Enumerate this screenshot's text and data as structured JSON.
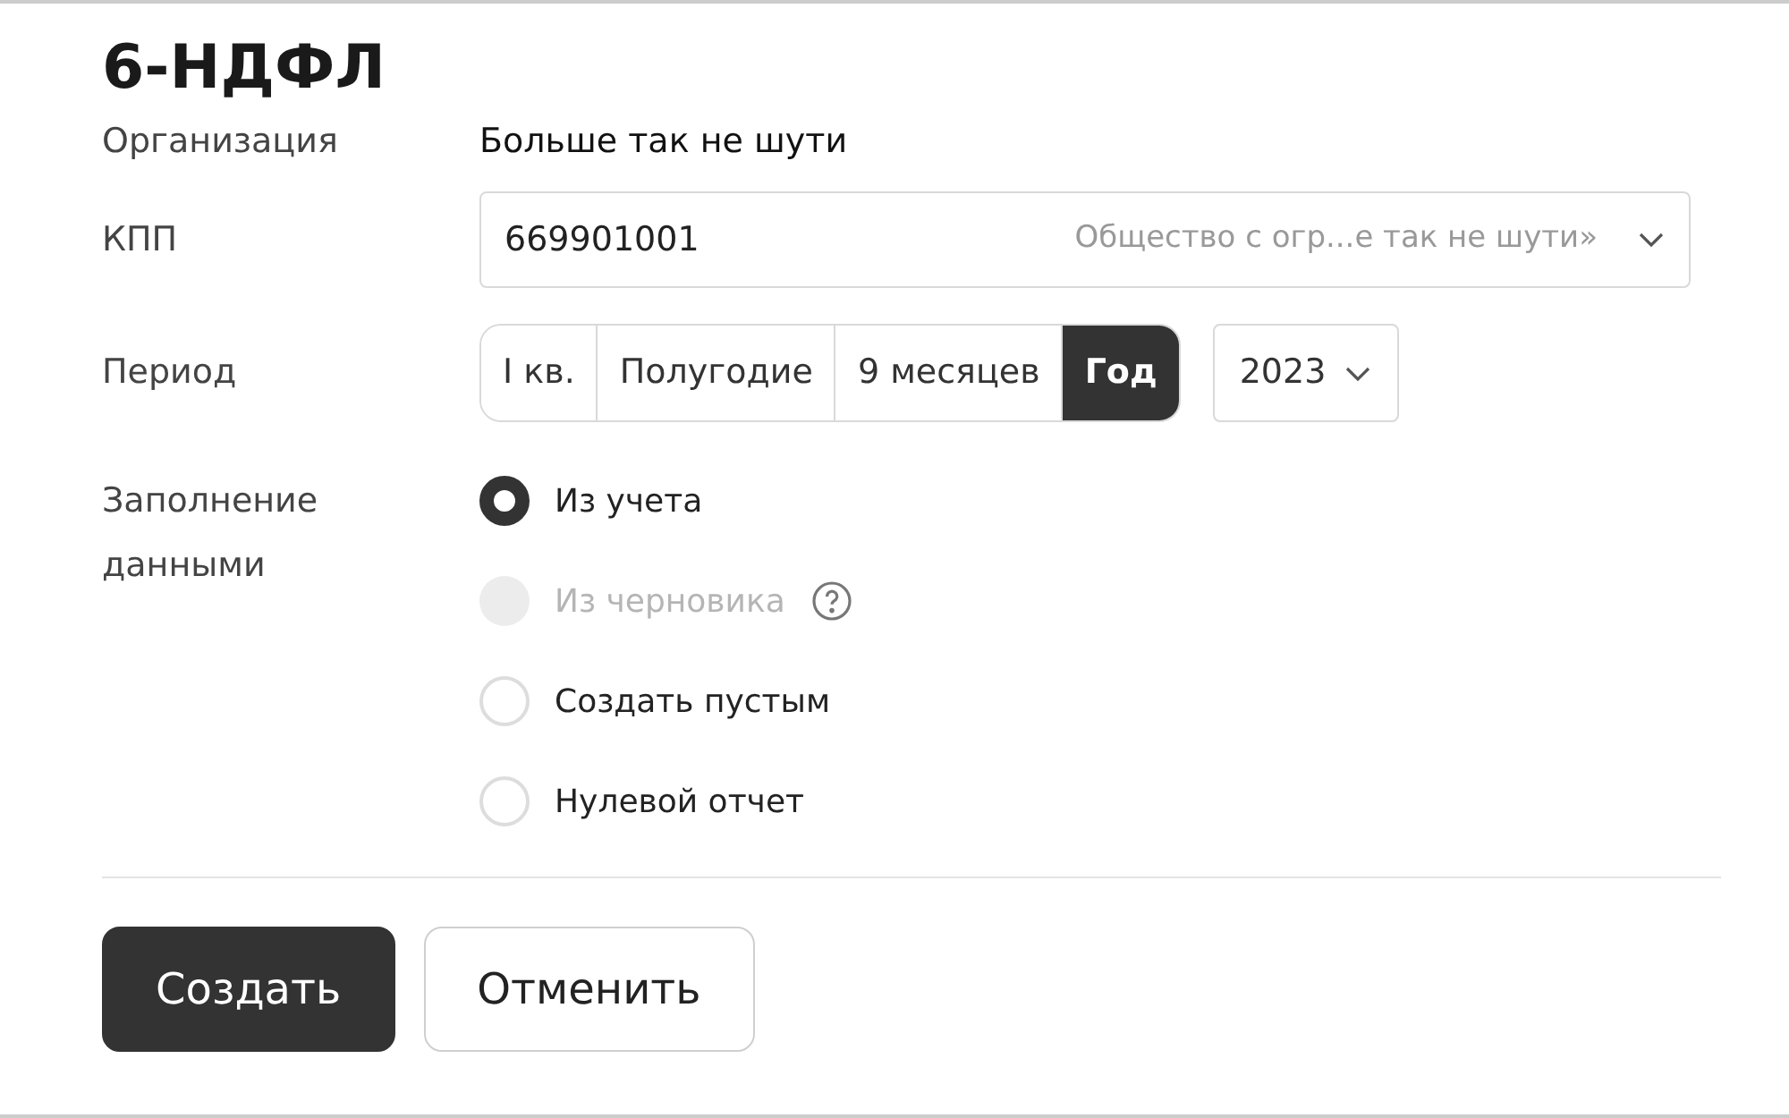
{
  "title": "6-НДФЛ",
  "organization": {
    "label": "Организация",
    "value": "Больше так не шути"
  },
  "kpp": {
    "label": "КПП",
    "value": "669901001",
    "description": "Общество с огр...е так не шути»"
  },
  "period": {
    "label": "Период",
    "options": [
      {
        "label": "I кв.",
        "selected": false
      },
      {
        "label": "Полугодие",
        "selected": false
      },
      {
        "label": "9 месяцев",
        "selected": false
      },
      {
        "label": "Год",
        "selected": true
      }
    ],
    "year": "2023"
  },
  "fill": {
    "label": "Заполнение данными",
    "options": [
      {
        "label": "Из учета",
        "selected": true,
        "disabled": false,
        "help": false
      },
      {
        "label": "Из черновика",
        "selected": false,
        "disabled": true,
        "help": true
      },
      {
        "label": "Создать пустым",
        "selected": false,
        "disabled": false,
        "help": false
      },
      {
        "label": "Нулевой отчет",
        "selected": false,
        "disabled": false,
        "help": false
      }
    ]
  },
  "buttons": [
    {
      "label": "Создать",
      "kind": "primary"
    },
    {
      "label": "Отменить",
      "kind": "secondary"
    }
  ]
}
